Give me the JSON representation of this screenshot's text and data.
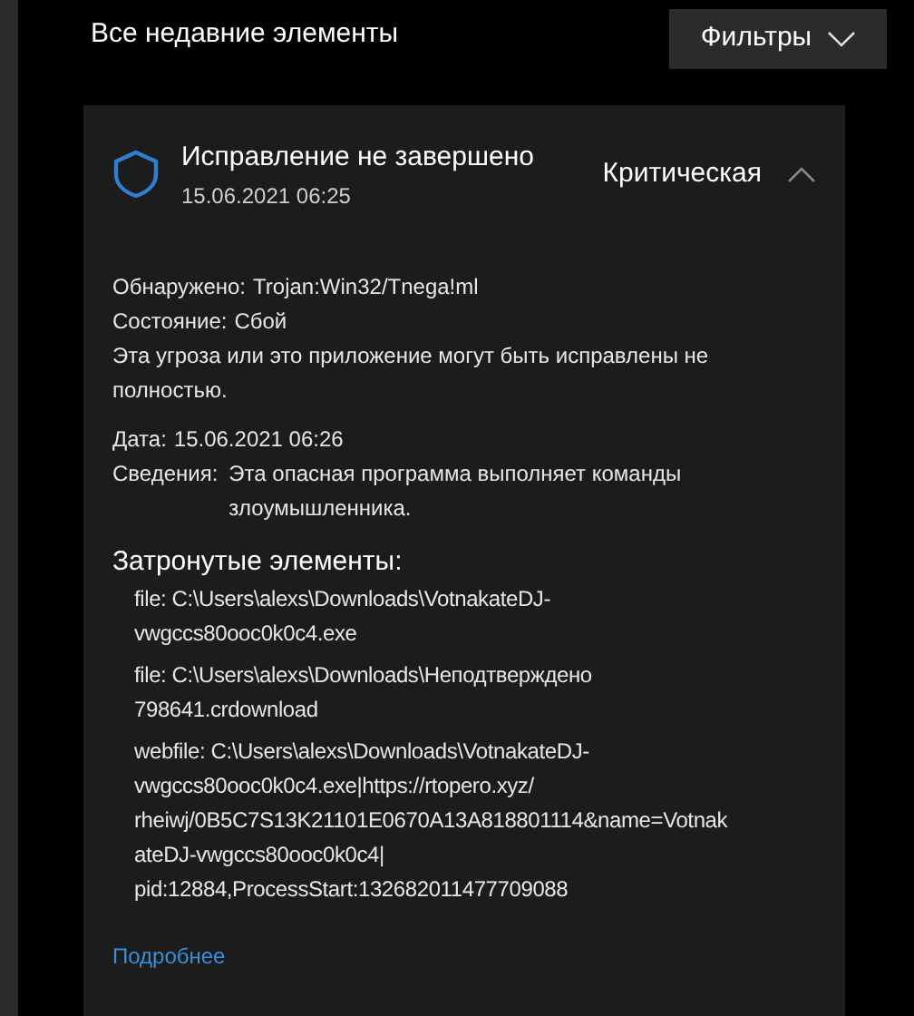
{
  "header": {
    "title": "Все недавние элементы",
    "filter_button": "Фильтры"
  },
  "threat": {
    "title": "Исправление не завершено",
    "date": "15.06.2021 06:25",
    "severity": "Критическая",
    "expanded": true,
    "details": [
      {
        "label": "Обнаружено:",
        "value": "Trojan:Win32/Tnega!ml"
      },
      {
        "label": "Состояние:",
        "value": "Сбой"
      }
    ],
    "description": [
      "Эта угроза или это приложение могут быть исправлены не",
      "полностью."
    ],
    "date_line": {
      "label": "Дата:",
      "value": "15.06.2021 06:26"
    },
    "info": {
      "label": "Сведения:",
      "lines": [
        "Эта опасная программа выполняет команды",
        "злоумышленника."
      ]
    },
    "affected_title": "Затронутые элементы:",
    "affected_items": [
      [
        "file: C:\\Users\\alexs\\Downloads\\VotnakateDJ-",
        "vwgccs80ooc0k0c4.exe"
      ],
      [
        "file: C:\\Users\\alexs\\Downloads\\Неподтверждено",
        "798641.crdownload"
      ],
      [
        "webfile: C:\\Users\\alexs\\Downloads\\VotnakateDJ-",
        "vwgccs80ooc0k0c4.exe|https://rtopero.xyz/",
        "rheiwj/0B5C7S13K21101E0670A13A818801114&name=Votnak",
        "ateDJ-vwgccs80ooc0k0c4|",
        "pid:12884,ProcessStart:132682011477709088"
      ]
    ],
    "more_link": "Подробнее"
  }
}
